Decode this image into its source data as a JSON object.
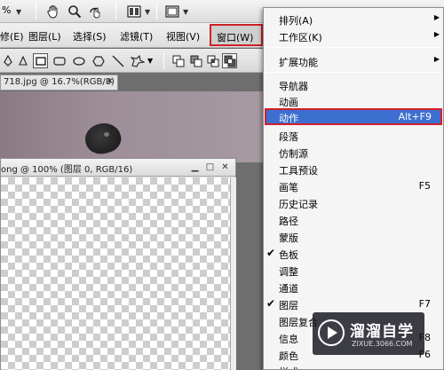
{
  "toolbar": {
    "zoom_text": "%",
    "icons": [
      "hand-icon",
      "zoom-icon",
      "rotate-view-icon",
      "arrange-documents-icon",
      "screen-mode-icon"
    ]
  },
  "menubar": {
    "items": [
      {
        "label": "修(E)"
      },
      {
        "label": "图层(L)"
      },
      {
        "label": "选择(S)"
      },
      {
        "label": "滤镜(T)"
      },
      {
        "label": "视图(V)"
      },
      {
        "label": "窗口(W)"
      }
    ]
  },
  "optbar": {
    "icons": [
      "pen-icon",
      "rectangle-tool-icon",
      "rounded-rectangle-icon",
      "ellipse-icon",
      "polygon-icon",
      "line-icon",
      "custom-shape-icon",
      "dropdown-icon",
      "new-layer-icon",
      "subtract-icon",
      "intersect-icon",
      "exclude-icon"
    ]
  },
  "documents": {
    "doc1_tab": "718.jpg @ 16.7%(RGB/8)",
    "doc1_close": "×",
    "doc2_title": "ong @ 100% (图层 0, RGB/16)"
  },
  "window_menu": {
    "items": [
      {
        "label": "排列(A)",
        "submenu": true
      },
      {
        "label": "工作区(K)",
        "submenu": true
      },
      {
        "separator": true
      },
      {
        "label": "扩展功能",
        "submenu": true
      },
      {
        "separator": true
      },
      {
        "label": "导航器"
      },
      {
        "label": "动画"
      },
      {
        "label": "动作",
        "shortcut": "Alt+F9",
        "highlighted": true
      },
      {
        "label": "段落"
      },
      {
        "label": "仿制源"
      },
      {
        "label": "工具预设"
      },
      {
        "label": "画笔",
        "shortcut": "F5"
      },
      {
        "label": "历史记录"
      },
      {
        "label": "路径"
      },
      {
        "label": "蒙版"
      },
      {
        "label": "色板",
        "checked": true
      },
      {
        "label": "调整"
      },
      {
        "label": "通道"
      },
      {
        "label": "图层",
        "shortcut": "F7",
        "checked": true
      },
      {
        "label": "图层复合"
      },
      {
        "label": "信息",
        "shortcut": "F8"
      },
      {
        "label": "颜色",
        "shortcut": "F6"
      },
      {
        "label": "样式"
      }
    ]
  },
  "watermark": {
    "title": "溜溜自学",
    "subtitle": "ZIXUE.3066.COM"
  },
  "colors": {
    "highlight": "#3d6fd0",
    "annotation_red": "#d0202a"
  }
}
